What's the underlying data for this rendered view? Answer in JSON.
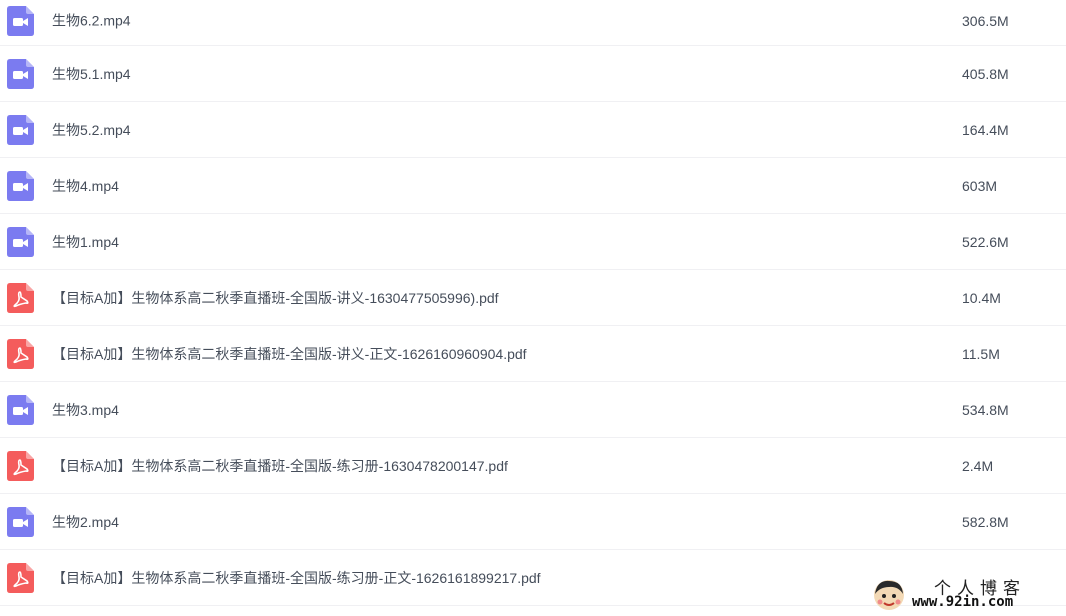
{
  "files": [
    {
      "name": "生物6.2.mp4",
      "size": "306.5M",
      "type": "video"
    },
    {
      "name": "生物5.1.mp4",
      "size": "405.8M",
      "type": "video"
    },
    {
      "name": "生物5.2.mp4",
      "size": "164.4M",
      "type": "video"
    },
    {
      "name": "生物4.mp4",
      "size": "603M",
      "type": "video"
    },
    {
      "name": "生物1.mp4",
      "size": "522.6M",
      "type": "video"
    },
    {
      "name": "【目标A加】生物体系高二秋季直播班-全国版-讲义-1630477505996).pdf",
      "size": "10.4M",
      "type": "pdf"
    },
    {
      "name": "【目标A加】生物体系高二秋季直播班-全国版-讲义-正文-1626160960904.pdf",
      "size": "11.5M",
      "type": "pdf"
    },
    {
      "name": "生物3.mp4",
      "size": "534.8M",
      "type": "video"
    },
    {
      "name": "【目标A加】生物体系高二秋季直播班-全国版-练习册-1630478200147.pdf",
      "size": "2.4M",
      "type": "pdf"
    },
    {
      "name": "生物2.mp4",
      "size": "582.8M",
      "type": "video"
    },
    {
      "name": "【目标A加】生物体系高二秋季直播班-全国版-练习册-正文-1626161899217.pdf",
      "size": "",
      "type": "pdf"
    }
  ],
  "icons": {
    "video": {
      "name": "video-file-icon",
      "color": "#7b7bf0"
    },
    "pdf": {
      "name": "pdf-file-icon",
      "color": "#f45c5c"
    }
  },
  "watermark": {
    "title": "个人博客",
    "url": "www.92in.com"
  }
}
